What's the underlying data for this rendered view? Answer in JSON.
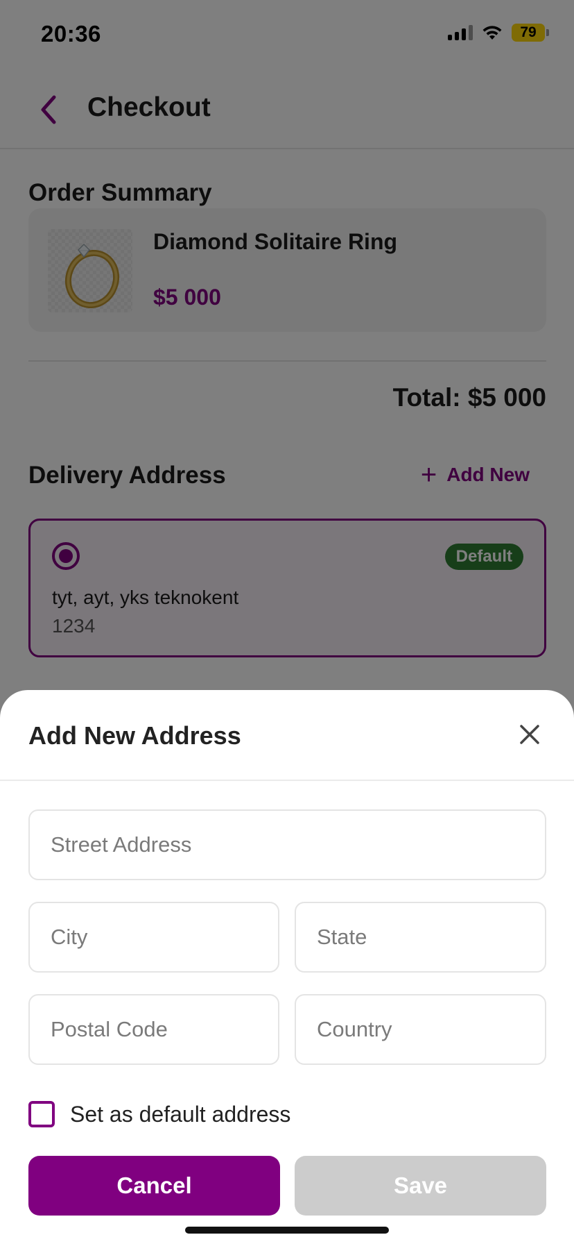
{
  "status_bar": {
    "time": "20:36",
    "battery": "79",
    "battery_color": "#ffd60a"
  },
  "header": {
    "back_icon": "chevron-left-icon",
    "title": "Checkout"
  },
  "order_summary": {
    "title": "Order Summary",
    "item": {
      "name": "Diamond Solitaire Ring",
      "price": "$5 000",
      "image_icon": "ring-image"
    },
    "total": "Total: $5 000"
  },
  "delivery": {
    "title": "Delivery Address",
    "add_new_icon": "plus-icon",
    "add_new_label": "Add New",
    "selected_address": {
      "line": "tyt, ayt, yks teknokent",
      "postal": "1234",
      "badge": "Default",
      "selected": true
    }
  },
  "sheet": {
    "title": "Add New Address",
    "close_icon": "close-icon",
    "fields": {
      "street": {
        "placeholder": "Street Address",
        "value": ""
      },
      "city": {
        "placeholder": "City",
        "value": ""
      },
      "state": {
        "placeholder": "State",
        "value": ""
      },
      "postal": {
        "placeholder": "Postal Code",
        "value": ""
      },
      "country": {
        "placeholder": "Country",
        "value": ""
      }
    },
    "default_checkbox": {
      "label": "Set as default address",
      "checked": false
    },
    "cancel_label": "Cancel",
    "save_label": "Save"
  },
  "colors": {
    "accent": "#800080",
    "badge_green": "#2e7d32",
    "disabled_button": "#cccccc"
  }
}
